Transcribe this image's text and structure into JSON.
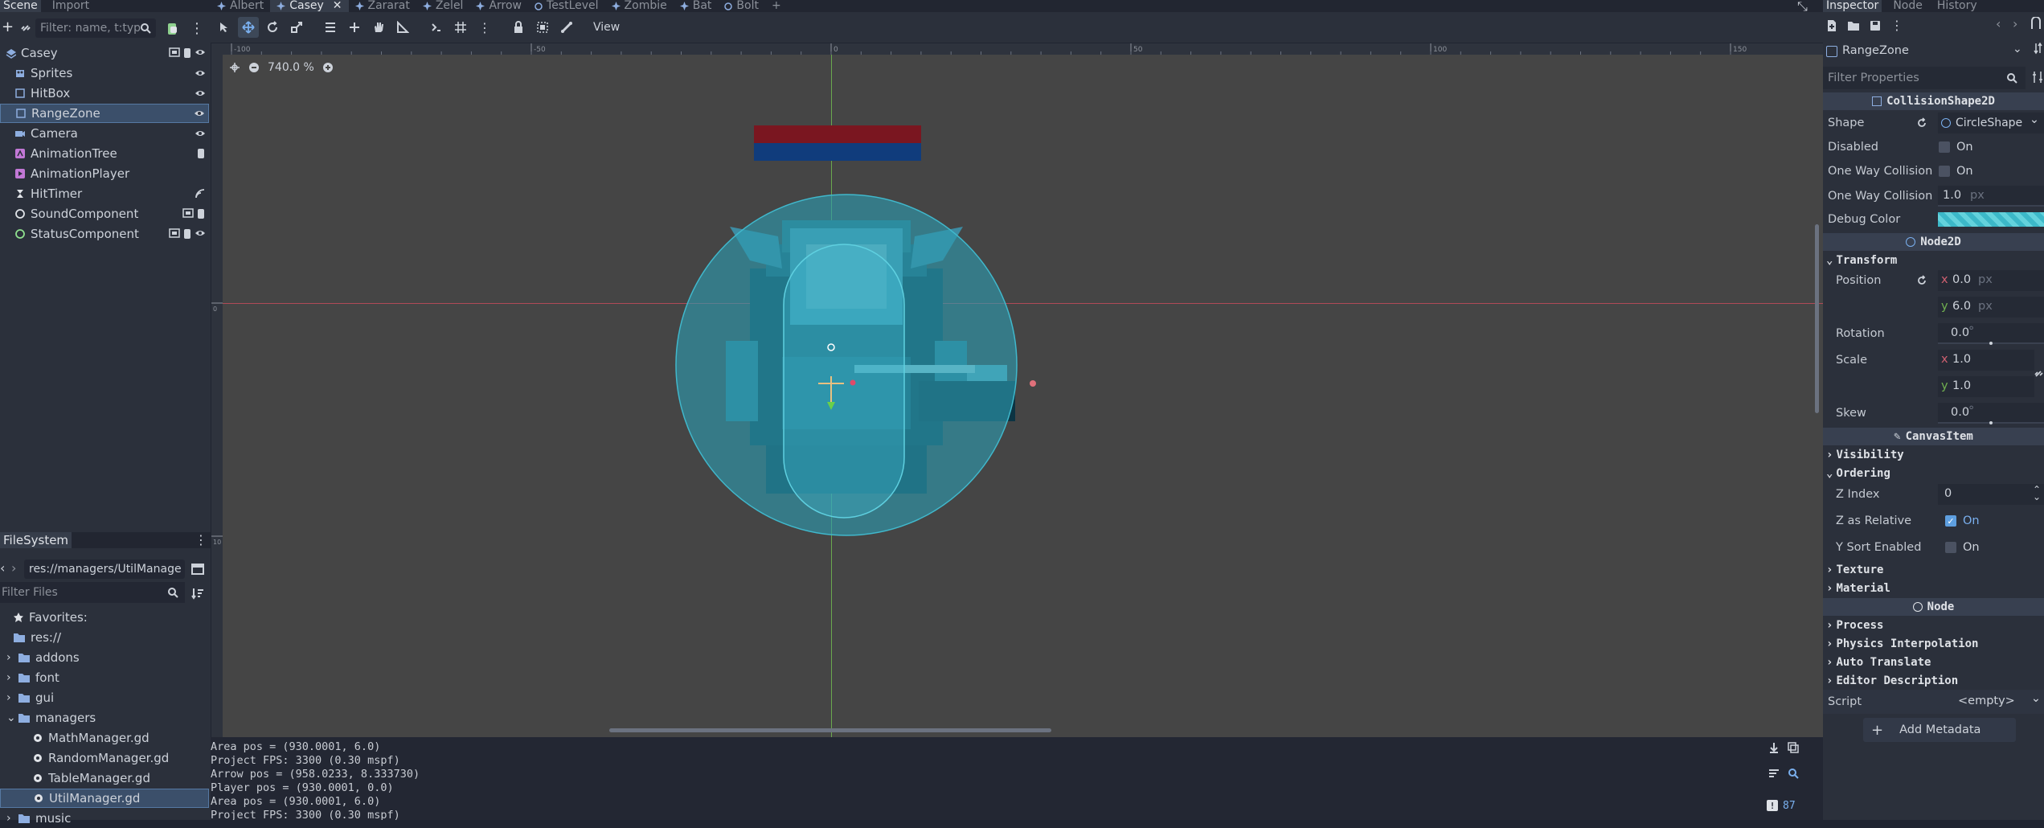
{
  "scene_dock": {
    "tabs": [
      "Scene",
      "Import"
    ],
    "filter_placeholder": "Filter: name, t:typ",
    "nodes": [
      {
        "name": "Casey",
        "icon": "group-icon",
        "color": "#8eaee0"
      },
      {
        "name": "Sprites",
        "icon": "sprite-icon",
        "color": "#8eaee0"
      },
      {
        "name": "HitBox",
        "icon": "area-icon",
        "color": "#8eaee0"
      },
      {
        "name": "RangeZone",
        "icon": "area-icon",
        "color": "#8eaee0"
      },
      {
        "name": "Camera",
        "icon": "camera-icon",
        "color": "#8eaee0"
      },
      {
        "name": "AnimationTree",
        "icon": "animation-tree-icon",
        "color": "#c278d6"
      },
      {
        "name": "AnimationPlayer",
        "icon": "animation-player-icon",
        "color": "#c278d6"
      },
      {
        "name": "HitTimer",
        "icon": "timer-icon",
        "color": "#e0e3e8"
      },
      {
        "name": "SoundComponent",
        "icon": "node-icon",
        "color": "#e0e3e8"
      },
      {
        "name": "StatusComponent",
        "icon": "node-icon",
        "color": "#8fe08f"
      }
    ]
  },
  "filesystem": {
    "tab": "FileSystem",
    "path": "res://managers/UtilManager",
    "filter_placeholder": "Filter Files",
    "items": [
      {
        "label": "Favorites:",
        "type": "favorites"
      },
      {
        "label": "res://",
        "type": "folder"
      },
      {
        "label": "addons",
        "type": "folder"
      },
      {
        "label": "font",
        "type": "folder"
      },
      {
        "label": "gui",
        "type": "folder"
      },
      {
        "label": "managers",
        "type": "folder"
      },
      {
        "label": "MathManager.gd",
        "type": "script"
      },
      {
        "label": "RandomManager.gd",
        "type": "script"
      },
      {
        "label": "TableManager.gd",
        "type": "script"
      },
      {
        "label": "UtilManager.gd",
        "type": "script"
      },
      {
        "label": "music",
        "type": "folder"
      }
    ]
  },
  "editor": {
    "tabs": [
      "Albert",
      "Casey",
      "Zararat",
      "Zelel",
      "Arrow",
      "TestLevel",
      "Zombie",
      "Bat",
      "Bolt"
    ],
    "active_tab": "Casey",
    "toolbar": {
      "view_label": "View"
    },
    "zoom_label": "740.0 %",
    "ruler_top_labels": [
      "-100",
      "-50",
      "0",
      "50",
      "100",
      "150"
    ],
    "ruler_left_labels": [
      "0",
      "10"
    ]
  },
  "console": {
    "lines": [
      "Area pos = (930.0001, 6.0)",
      "Project FPS: 3300 (0.30 mspf)",
      "Arrow pos = (958.0233, 8.333730)",
      "Player pos = (930.0001, 0.0)",
      "Area pos = (930.0001, 6.0)",
      "Project FPS: 3300 (0.30 mspf)"
    ],
    "badge_count": "87"
  },
  "inspector": {
    "tabs": [
      "Inspector",
      "Node",
      "History"
    ],
    "node_name": "RangeZone",
    "filter_placeholder": "Filter Properties",
    "collision_shape_header": "CollisionShape2D",
    "shape_label": "Shape",
    "shape_value": "CircleShape",
    "disabled_label": "Disabled",
    "disabled_value": "On",
    "one_way_label": "One Way Collision",
    "one_way_value": "On",
    "one_way_margin_label": "One Way Collision",
    "one_way_margin_value": "1.0",
    "px_unit": "px",
    "debug_color_label": "Debug Color",
    "node2d_header": "Node2D",
    "transform_label": "Transform",
    "position_label": "Position",
    "position_x": "0.0",
    "position_y": "6.0",
    "rotation_label": "Rotation",
    "rotation_value": "0.0",
    "degree_unit": "°",
    "scale_label": "Scale",
    "scale_x": "1.0",
    "scale_y": "1.0",
    "skew_label": "Skew",
    "skew_value": "0.0",
    "canvas_item_header": "CanvasItem",
    "visibility_label": "Visibility",
    "ordering_label": "Ordering",
    "z_index_label": "Z Index",
    "z_index_value": "0",
    "z_relative_label": "Z as Relative",
    "z_relative_value": "On",
    "y_sort_label": "Y Sort Enabled",
    "y_sort_value": "On",
    "texture_label": "Texture",
    "material_label": "Material",
    "node_header": "Node",
    "process_label": "Process",
    "physics_interp_label": "Physics Interpolation",
    "auto_translate_label": "Auto Translate",
    "editor_desc_label": "Editor Description",
    "script_label": "Script",
    "script_value": "<empty>",
    "add_metadata_label": "Add Metadata",
    "axis_x": "x",
    "axis_y": "y"
  },
  "colors": {
    "accent": "#5e9fe0",
    "selection": "#3b4f6a",
    "health_red": "#7a1620",
    "health_blue": "#103c7c"
  }
}
